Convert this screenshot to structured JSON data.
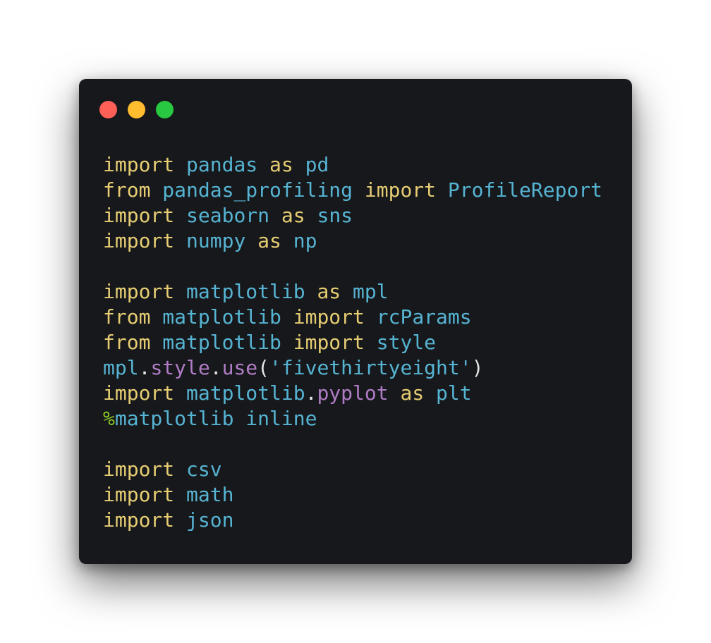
{
  "window": {
    "traffic_lights": [
      {
        "name": "close-button",
        "icon": "red-circle-icon",
        "color": "#fe5f57"
      },
      {
        "name": "minimize-button",
        "icon": "yellow-circle-icon",
        "color": "#febc2e"
      },
      {
        "name": "maximize-button",
        "icon": "green-circle-icon",
        "color": "#28c840"
      }
    ]
  },
  "colors": {
    "background": "#17181b",
    "keyword": "#e6cd73",
    "name": "#56b4d3",
    "attribute": "#b07cc6",
    "punctuation": "#e6e6e6",
    "magic": "#8ac926"
  },
  "code": {
    "language": "python",
    "lines": [
      [
        {
          "t": "keyword",
          "v": "import"
        },
        {
          "t": "space",
          "v": " "
        },
        {
          "t": "name",
          "v": "pandas"
        },
        {
          "t": "space",
          "v": " "
        },
        {
          "t": "keyword",
          "v": "as"
        },
        {
          "t": "space",
          "v": " "
        },
        {
          "t": "name",
          "v": "pd"
        }
      ],
      [
        {
          "t": "keyword",
          "v": "from"
        },
        {
          "t": "space",
          "v": " "
        },
        {
          "t": "name",
          "v": "pandas_profiling"
        },
        {
          "t": "space",
          "v": " "
        },
        {
          "t": "keyword",
          "v": "import"
        },
        {
          "t": "space",
          "v": " "
        },
        {
          "t": "name",
          "v": "ProfileReport"
        }
      ],
      [
        {
          "t": "keyword",
          "v": "import"
        },
        {
          "t": "space",
          "v": " "
        },
        {
          "t": "name",
          "v": "seaborn"
        },
        {
          "t": "space",
          "v": " "
        },
        {
          "t": "keyword",
          "v": "as"
        },
        {
          "t": "space",
          "v": " "
        },
        {
          "t": "name",
          "v": "sns"
        }
      ],
      [
        {
          "t": "keyword",
          "v": "import"
        },
        {
          "t": "space",
          "v": " "
        },
        {
          "t": "name",
          "v": "numpy"
        },
        {
          "t": "space",
          "v": " "
        },
        {
          "t": "keyword",
          "v": "as"
        },
        {
          "t": "space",
          "v": " "
        },
        {
          "t": "name",
          "v": "np"
        }
      ],
      [],
      [
        {
          "t": "keyword",
          "v": "import"
        },
        {
          "t": "space",
          "v": " "
        },
        {
          "t": "name",
          "v": "matplotlib"
        },
        {
          "t": "space",
          "v": " "
        },
        {
          "t": "keyword",
          "v": "as"
        },
        {
          "t": "space",
          "v": " "
        },
        {
          "t": "name",
          "v": "mpl"
        }
      ],
      [
        {
          "t": "keyword",
          "v": "from"
        },
        {
          "t": "space",
          "v": " "
        },
        {
          "t": "name",
          "v": "matplotlib"
        },
        {
          "t": "space",
          "v": " "
        },
        {
          "t": "keyword",
          "v": "import"
        },
        {
          "t": "space",
          "v": " "
        },
        {
          "t": "name",
          "v": "rcParams"
        }
      ],
      [
        {
          "t": "keyword",
          "v": "from"
        },
        {
          "t": "space",
          "v": " "
        },
        {
          "t": "name",
          "v": "matplotlib"
        },
        {
          "t": "space",
          "v": " "
        },
        {
          "t": "keyword",
          "v": "import"
        },
        {
          "t": "space",
          "v": " "
        },
        {
          "t": "name",
          "v": "style"
        }
      ],
      [
        {
          "t": "name",
          "v": "mpl"
        },
        {
          "t": "punct",
          "v": "."
        },
        {
          "t": "attr",
          "v": "style"
        },
        {
          "t": "punct",
          "v": "."
        },
        {
          "t": "attr",
          "v": "use"
        },
        {
          "t": "punct",
          "v": "("
        },
        {
          "t": "string",
          "v": "'fivethirtyeight'"
        },
        {
          "t": "punct",
          "v": ")"
        }
      ],
      [
        {
          "t": "keyword",
          "v": "import"
        },
        {
          "t": "space",
          "v": " "
        },
        {
          "t": "name",
          "v": "matplotlib"
        },
        {
          "t": "punct",
          "v": "."
        },
        {
          "t": "attr",
          "v": "pyplot"
        },
        {
          "t": "space",
          "v": " "
        },
        {
          "t": "keyword",
          "v": "as"
        },
        {
          "t": "space",
          "v": " "
        },
        {
          "t": "name",
          "v": "plt"
        }
      ],
      [
        {
          "t": "magic",
          "v": "%"
        },
        {
          "t": "name",
          "v": "matplotlib"
        },
        {
          "t": "space",
          "v": " "
        },
        {
          "t": "name",
          "v": "inline"
        }
      ],
      [],
      [
        {
          "t": "keyword",
          "v": "import"
        },
        {
          "t": "space",
          "v": " "
        },
        {
          "t": "name",
          "v": "csv"
        }
      ],
      [
        {
          "t": "keyword",
          "v": "import"
        },
        {
          "t": "space",
          "v": " "
        },
        {
          "t": "name",
          "v": "math"
        }
      ],
      [
        {
          "t": "keyword",
          "v": "import"
        },
        {
          "t": "space",
          "v": " "
        },
        {
          "t": "name",
          "v": "json"
        }
      ]
    ]
  }
}
